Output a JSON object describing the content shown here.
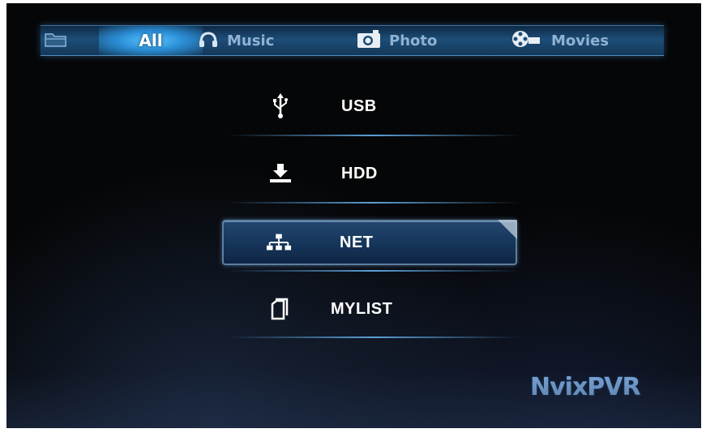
{
  "tabs": [
    {
      "icon": "folder-icon",
      "label": ""
    },
    {
      "icon": "",
      "label": "All"
    },
    {
      "icon": "headphones-icon",
      "label": "Music"
    },
    {
      "icon": "camera-icon",
      "label": "Photo"
    },
    {
      "icon": "film-reel-icon",
      "label": "Movies"
    }
  ],
  "selected_tab": "All",
  "menu": [
    {
      "icon": "usb-icon",
      "label": "USB"
    },
    {
      "icon": "hdd-icon",
      "label": "HDD"
    },
    {
      "icon": "network-icon",
      "label": "NET"
    },
    {
      "icon": "document-icon",
      "label": "MYLIST"
    }
  ],
  "selected_menu": "NET",
  "brand": "NvixPVR",
  "colors": {
    "background": "#050607",
    "accent": "#2a8ed6",
    "selection": "#16365c",
    "text": "#ffffff",
    "tab_text": "#8fb2d3"
  }
}
